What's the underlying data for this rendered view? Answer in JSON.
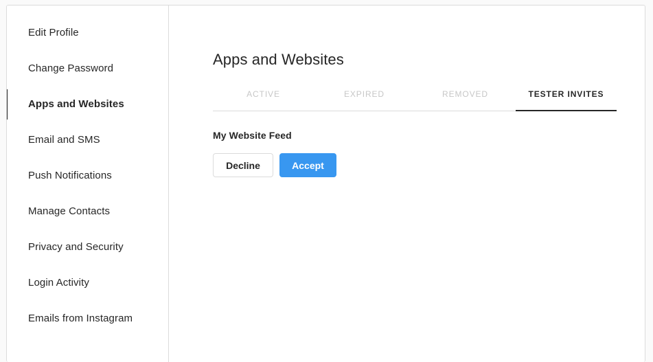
{
  "sidebar": {
    "items": [
      {
        "label": "Edit Profile",
        "key": "edit-profile",
        "active": false
      },
      {
        "label": "Change Password",
        "key": "change-password",
        "active": false
      },
      {
        "label": "Apps and Websites",
        "key": "apps-and-websites",
        "active": true
      },
      {
        "label": "Email and SMS",
        "key": "email-and-sms",
        "active": false
      },
      {
        "label": "Push Notifications",
        "key": "push-notifications",
        "active": false
      },
      {
        "label": "Manage Contacts",
        "key": "manage-contacts",
        "active": false
      },
      {
        "label": "Privacy and Security",
        "key": "privacy-and-security",
        "active": false
      },
      {
        "label": "Login Activity",
        "key": "login-activity",
        "active": false
      },
      {
        "label": "Emails from Instagram",
        "key": "emails-from-instagram",
        "active": false
      }
    ]
  },
  "main": {
    "title": "Apps and Websites",
    "tabs": [
      {
        "label": "ACTIVE",
        "key": "active",
        "selected": false
      },
      {
        "label": "EXPIRED",
        "key": "expired",
        "selected": false
      },
      {
        "label": "REMOVED",
        "key": "removed",
        "selected": false
      },
      {
        "label": "TESTER INVITES",
        "key": "tester-invites",
        "selected": true
      }
    ],
    "invites": [
      {
        "name": "My Website Feed",
        "decline_label": "Decline",
        "accept_label": "Accept"
      }
    ]
  },
  "colors": {
    "accent": "#3897f0",
    "text": "#262626",
    "muted_text": "#c7c7c7",
    "border": "#dbdbdb",
    "page_background": "#fafafa",
    "card_background": "#ffffff"
  }
}
